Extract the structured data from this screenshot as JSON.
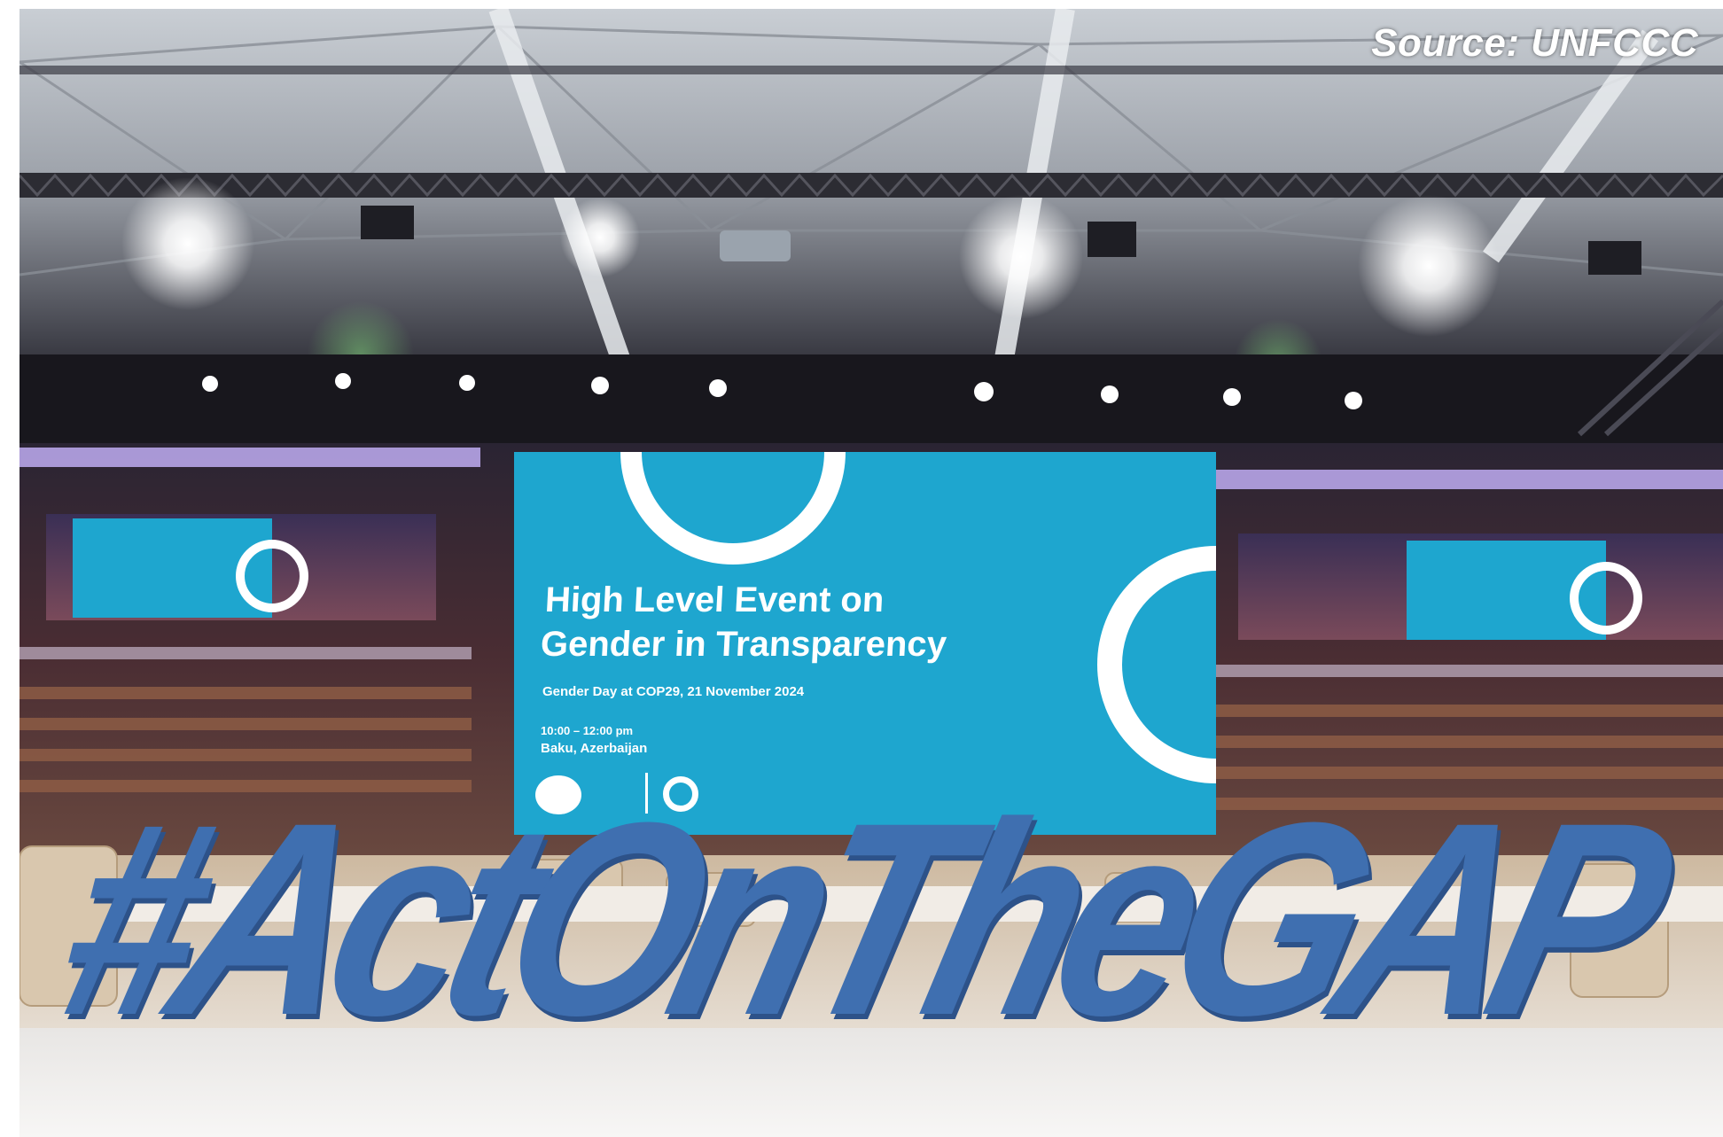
{
  "credit": "Source: UNFCCC",
  "screen": {
    "title_line1": "High Level Event on",
    "title_line2": "Gender in Transparency",
    "subtitle": "Gender Day at COP29, 21 November 2024",
    "time": "10:00 – 12:00 pm",
    "location": "Baku, Azerbaijan"
  },
  "sign": {
    "text": "#ActOnTheGAP"
  },
  "colors": {
    "screen_blue": "#1ea6cf",
    "sign_blue": "#3f6fb0",
    "credit_text": "#ffffff"
  }
}
